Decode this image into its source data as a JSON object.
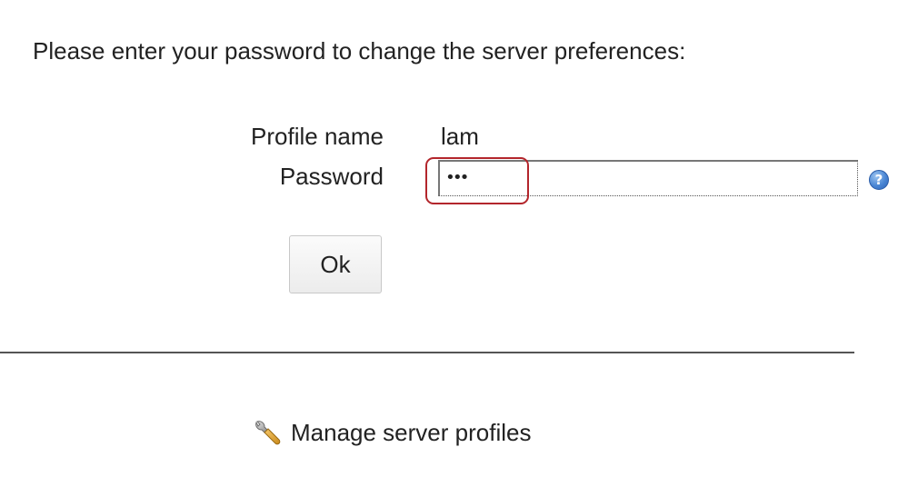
{
  "intro": {
    "text": "Please enter your password to change the server preferences:"
  },
  "form": {
    "profile_label": "Profile name",
    "profile_value": "lam",
    "password_label": "Password",
    "password_value": "•••",
    "help_glyph": "?",
    "ok_label": "Ok"
  },
  "footer": {
    "manage_label": "Manage server profiles"
  },
  "icons": {
    "help": "help-icon",
    "manage": "wrench-icon"
  },
  "colors": {
    "highlight": "#b3262c",
    "help_blue": "#4a86d4"
  }
}
